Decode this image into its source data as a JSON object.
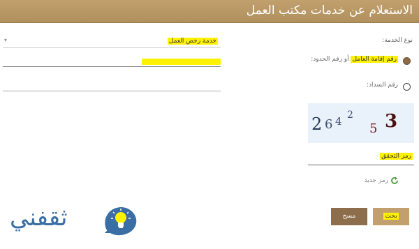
{
  "header": {
    "title": "الاستعلام عن خدمات مكتب العمل"
  },
  "form": {
    "service_type_label": "نوع الخدمة:",
    "service_select_value": "خدمة رخص العمل",
    "radio_iqama_highlight": "رقم إقامة العامل",
    "radio_iqama_rest": " أو رقم الحدود:",
    "radio_payment_label": "رقم السداد:",
    "captcha_label": "رمز التحقق",
    "new_code_label": "رمز جديد"
  },
  "captcha": {
    "chars": [
      "2",
      "6",
      "4",
      "2",
      "5",
      "3"
    ]
  },
  "buttons": {
    "search_label": "بحث",
    "clear_label": "مسح"
  },
  "logo": {
    "text": "ثقفني"
  },
  "colors": {
    "header": "#c1a06d",
    "button": "#c1a06d",
    "button_dark": "#8c6d4c",
    "highlight": "#fff200",
    "logo": "#3a6ea5"
  }
}
